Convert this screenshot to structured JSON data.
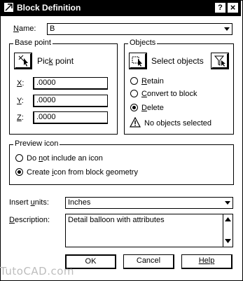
{
  "window": {
    "title": "Block Definition",
    "help_btn": "?",
    "close_btn": "x"
  },
  "name": {
    "label": "Name:",
    "value": "B"
  },
  "base_point": {
    "title": "Base point",
    "pick_label": "Pick point",
    "x_label": "X:",
    "x_value": ".0000",
    "y_label": "Y:",
    "y_value": ".0000",
    "z_label": "Z:",
    "z_value": ".0000"
  },
  "objects": {
    "title": "Objects",
    "select_label": "Select objects",
    "options": [
      {
        "label": "Retain",
        "selected": false
      },
      {
        "label": "Convert to block",
        "selected": false
      },
      {
        "label": "Delete",
        "selected": true
      }
    ],
    "status": "No objects selected"
  },
  "preview": {
    "title": "Preview icon",
    "options": [
      {
        "label": "Do not include an icon",
        "selected": false
      },
      {
        "label": "Create icon from block geometry",
        "selected": true
      }
    ]
  },
  "insert_units": {
    "label": "Insert units:",
    "value": "Inches"
  },
  "description": {
    "label": "Description:",
    "value": "Detail balloon with attributes"
  },
  "buttons": {
    "ok": "OK",
    "cancel": "Cancel",
    "help": "Help"
  },
  "watermark": "TutoCAD.com"
}
